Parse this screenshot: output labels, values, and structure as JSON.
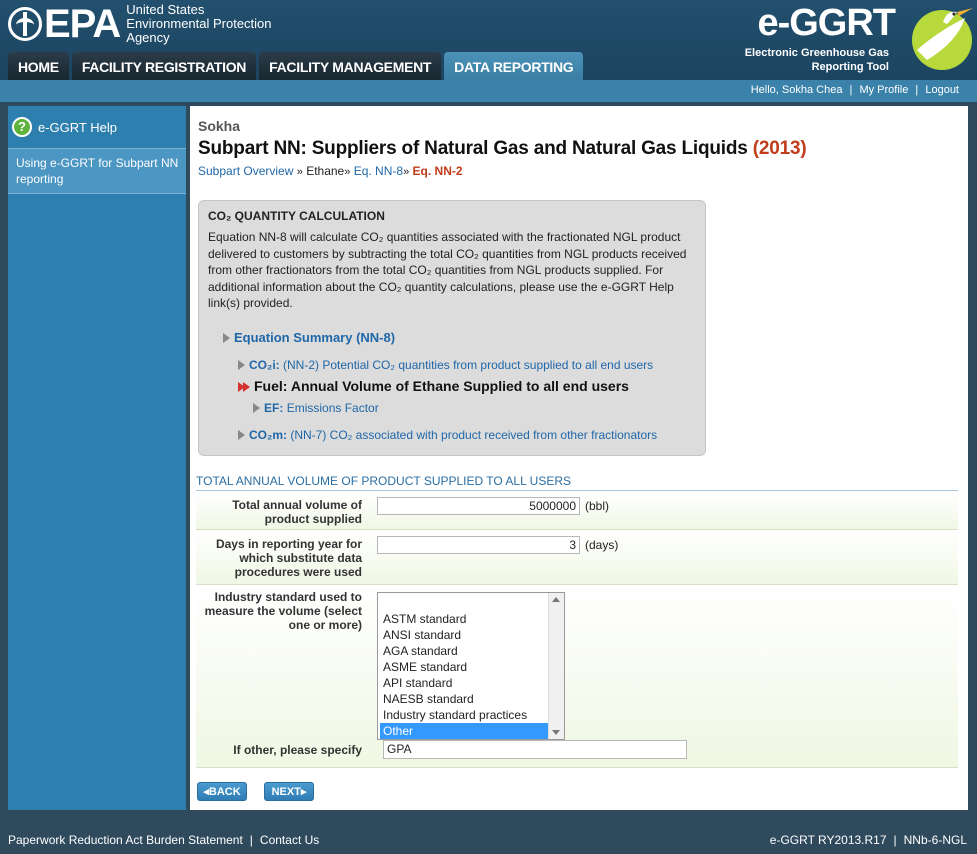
{
  "header": {
    "agency_word": "EPA",
    "agency_lines": [
      "United States",
      "Environmental Protection",
      "Agency"
    ],
    "app_title": "e-GGRT",
    "app_subtitle_1": "Electronic Greenhouse Gas",
    "app_subtitle_2": "Reporting Tool",
    "nav": [
      {
        "label": "HOME",
        "active": false
      },
      {
        "label": "FACILITY REGISTRATION",
        "active": false
      },
      {
        "label": "FACILITY MANAGEMENT",
        "active": false
      },
      {
        "label": "DATA REPORTING",
        "active": true
      }
    ]
  },
  "userbar": {
    "greeting": "Hello, Sokha Chea",
    "profile": "My Profile",
    "logout": "Logout"
  },
  "sidebar": {
    "help_title": "e-GGRT Help",
    "help_link": "Using e-GGRT for Subpart NN reporting"
  },
  "main": {
    "facility": "Sokha",
    "title": "Subpart NN: Suppliers of Natural Gas and Natural Gas Liquids ",
    "year": "(2013)",
    "breadcrumb": {
      "overview": "Subpart Overview",
      "sep": "»",
      "ethane": "Ethane",
      "eq1": "Eq. NN-8",
      "eq2": "Eq. NN-2"
    }
  },
  "calc": {
    "title": "CO₂ QUANTITY CALCULATION",
    "description": "Equation NN-8 will calculate CO₂ quantities associated with the fractionated NGL product delivered to customers by subtracting the total CO₂ quantities from NGL products received from other fractionators from the total CO₂ quantities from NGL products supplied. For additional information about the CO₂ quantity calculations, please use the e-GGRT Help link(s) provided.",
    "tree": {
      "summary": "Equation Summary (NN-8)",
      "co2i_label": "CO₂i:",
      "co2i_text": "(NN-2) Potential CO₂ quantities from product supplied to all end users",
      "fuel_label": "Fuel:",
      "fuel_text": "Annual Volume of Ethane Supplied to all end users",
      "ef_label": "EF:",
      "ef_text": "Emissions Factor",
      "co2m_label": "CO₂m:",
      "co2m_text": "(NN-7) CO₂ associated with product received from other fractionators"
    }
  },
  "form": {
    "section_title": "TOTAL ANNUAL VOLUME OF PRODUCT SUPPLIED TO ALL USERS",
    "volume_label": "Total annual volume of product supplied",
    "volume_value": "5000000",
    "volume_unit": "(bbl)",
    "days_label": "Days in reporting year for which substitute data procedures were used",
    "days_value": "3",
    "days_unit": "(days)",
    "standard_label": "Industry standard used to measure the volume (select one or more)",
    "standard_options": [
      "ASTM standard",
      "ANSI standard",
      "AGA standard",
      "ASME standard",
      "API standard",
      "NAESB standard",
      "Industry standard practices",
      "Other"
    ],
    "standard_selected": "Other",
    "other_label": "If other, please specify",
    "other_value": "GPA"
  },
  "buttons": {
    "back": "BACK",
    "next": "NEXT"
  },
  "footer": {
    "paperwork": "Paperwork Reduction Act Burden Statement",
    "contact": "Contact Us",
    "version": "e-GGRT RY2013.R17",
    "page_id": "NNb-6-NGL"
  },
  "colors": {
    "accent_blue": "#1f67a8",
    "year_red": "#c03c1b",
    "nav_active": "#4c92b8",
    "selected_option": "#3399ff"
  }
}
